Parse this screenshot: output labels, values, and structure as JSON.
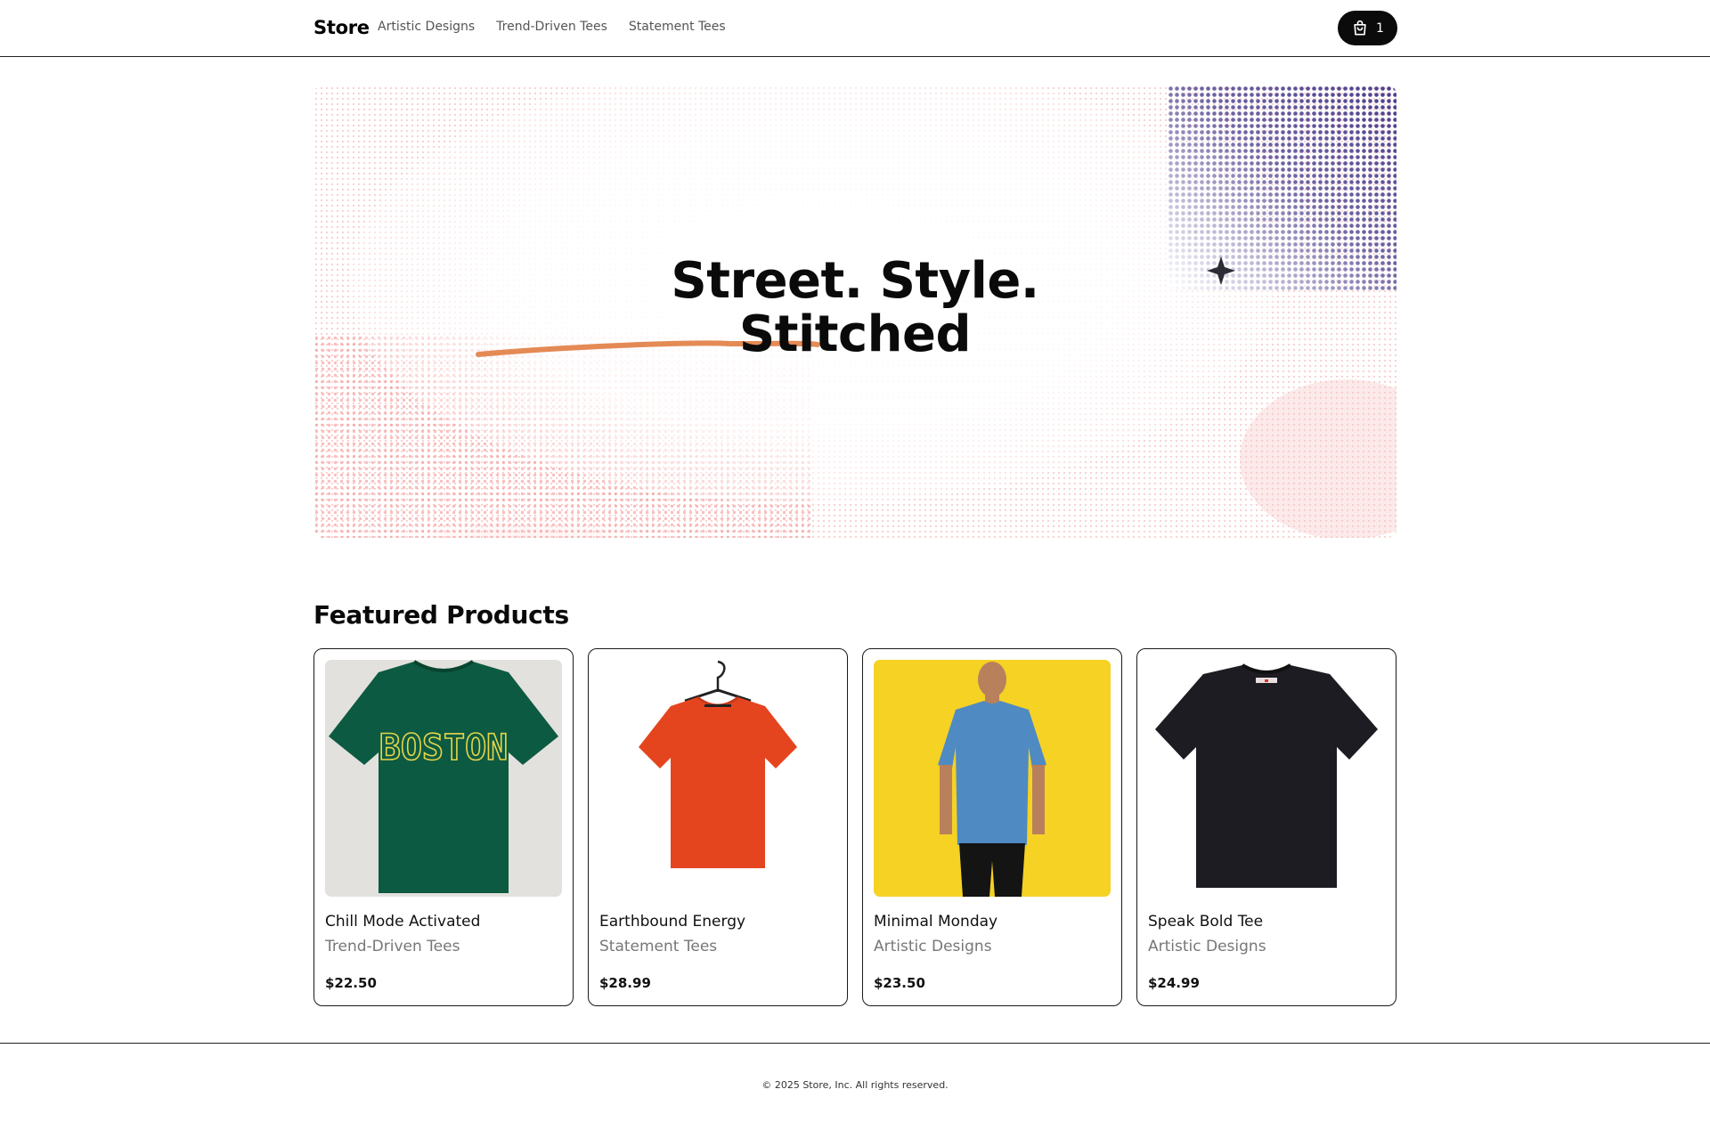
{
  "header": {
    "brand": "Store",
    "nav": [
      "Artistic Designs",
      "Trend-Driven Tees",
      "Statement Tees"
    ],
    "cart_count": "1",
    "cart_icon": "shopping-bag-icon"
  },
  "hero": {
    "title_line1": "Street. Style.",
    "title_line2": "Stitched",
    "colors": {
      "pink": "#f26b6b",
      "purple": "#4b3d8c",
      "stroke": "#e48a55"
    }
  },
  "featured": {
    "title": "Featured Products",
    "products": [
      {
        "name": "Chill Mode Activated",
        "category": "Trend-Driven Tees",
        "price": "$22.50",
        "print": "BOSTON",
        "color": "#0c5a41"
      },
      {
        "name": "Earthbound Energy",
        "category": "Statement Tees",
        "price": "$28.99",
        "color": "#e4451f"
      },
      {
        "name": "Minimal Monday",
        "category": "Artistic Designs",
        "price": "$23.50",
        "color": "#4f8ac2"
      },
      {
        "name": "Speak Bold Tee",
        "category": "Artistic Designs",
        "price": "$24.99",
        "color": "#1d1c22"
      }
    ]
  },
  "footer": {
    "text": "© 2025 Store, Inc. All rights reserved."
  }
}
